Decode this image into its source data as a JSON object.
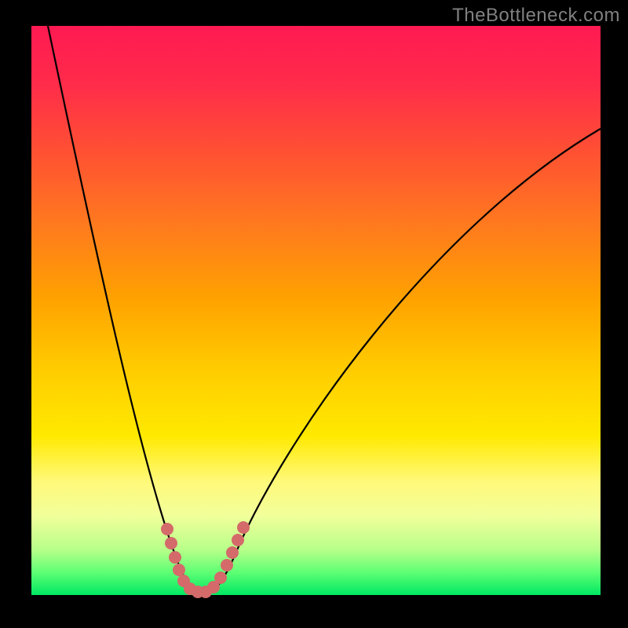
{
  "watermark": "TheBottleneck.com",
  "chart_data": {
    "type": "line",
    "title": "",
    "xlabel": "",
    "ylabel": "",
    "xlim": [
      0,
      100
    ],
    "ylim": [
      0,
      100
    ],
    "background_gradient_stops": [
      {
        "pct": 0,
        "color": "#ff1a52"
      },
      {
        "pct": 10,
        "color": "#ff2b4a"
      },
      {
        "pct": 22,
        "color": "#ff5033"
      },
      {
        "pct": 35,
        "color": "#ff7a1e"
      },
      {
        "pct": 48,
        "color": "#ffa200"
      },
      {
        "pct": 60,
        "color": "#ffcb00"
      },
      {
        "pct": 72,
        "color": "#ffe900"
      },
      {
        "pct": 80,
        "color": "#fff97a"
      },
      {
        "pct": 86,
        "color": "#f2ff9a"
      },
      {
        "pct": 92,
        "color": "#b8ff8a"
      },
      {
        "pct": 96,
        "color": "#5eff74"
      },
      {
        "pct": 100,
        "color": "#00e863"
      }
    ],
    "series": [
      {
        "name": "bottleneck-curve",
        "color": "#000000",
        "x": [
          3,
          8,
          13,
          18,
          22,
          25,
          27,
          29,
          30,
          31,
          33,
          36,
          40,
          46,
          54,
          64,
          76,
          90,
          100
        ],
        "values": [
          100,
          80,
          62,
          46,
          32,
          20,
          11,
          4,
          1,
          0,
          1,
          6,
          14,
          26,
          40,
          55,
          68,
          78,
          82
        ]
      }
    ],
    "highlight": {
      "name": "trough-markers",
      "color": "#d46a6a",
      "x": [
        24,
        25,
        26,
        27,
        28,
        29,
        30,
        31,
        32,
        33,
        34,
        35,
        36,
        37
      ],
      "values": [
        12,
        10,
        7,
        5,
        3,
        1,
        0,
        0,
        1,
        3,
        5,
        7,
        9,
        12
      ]
    }
  }
}
